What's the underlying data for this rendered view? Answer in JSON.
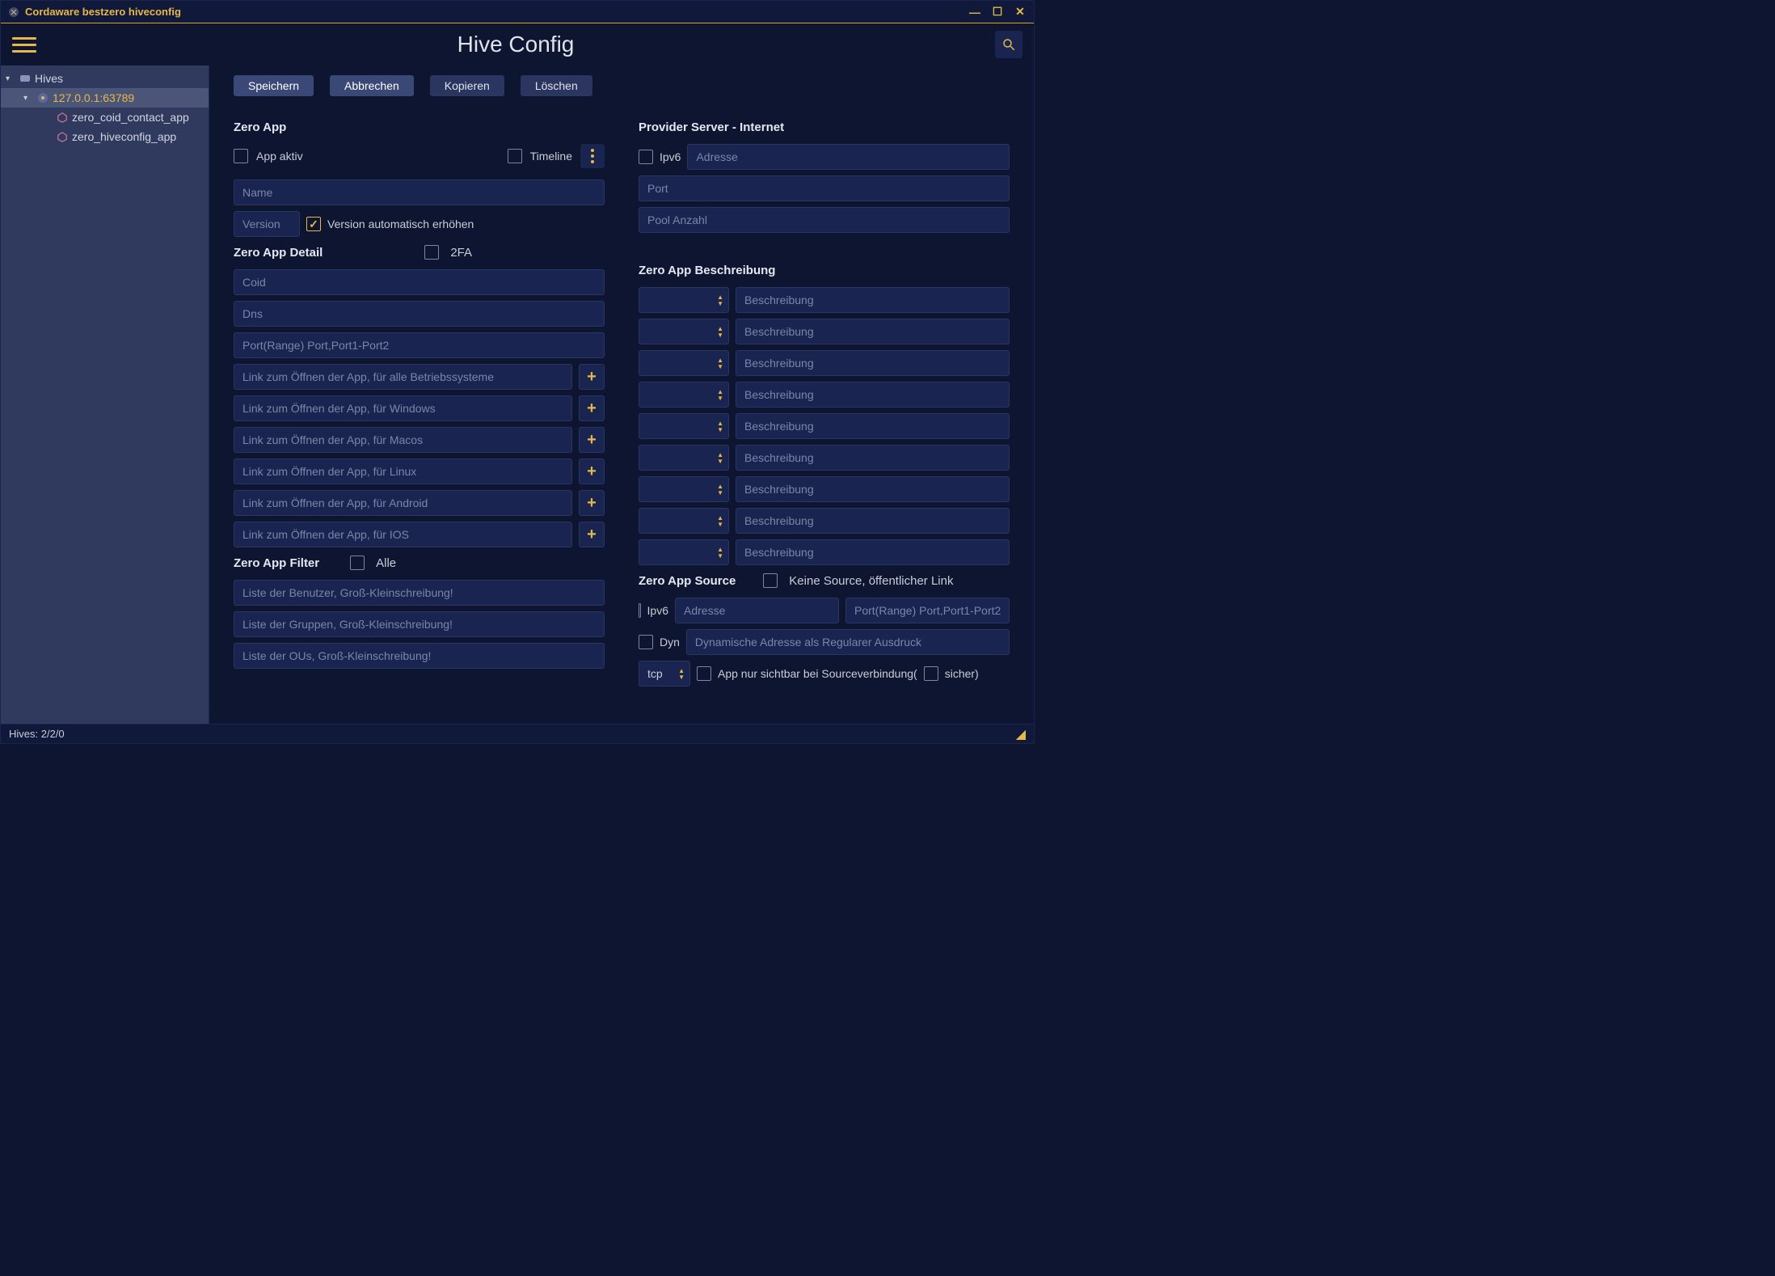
{
  "window": {
    "title": "Cordaware bestzero hiveconfig"
  },
  "header": {
    "page_title": "Hive Config"
  },
  "toolbar": {
    "save": "Speichern",
    "cancel": "Abbrechen",
    "copy": "Kopieren",
    "delete": "Löschen"
  },
  "tree": {
    "root": "Hives",
    "node": "127.0.0.1:63789",
    "app1": "zero_coid_contact_app",
    "app2": "zero_hiveconfig_app"
  },
  "zeroapp": {
    "title": "Zero App",
    "app_active": "App aktiv",
    "timeline": "Timeline",
    "name_ph": "Name",
    "version_ph": "Version",
    "version_auto": "Version automatisch erhöhen"
  },
  "detail": {
    "title": "Zero App Detail",
    "twofa": "2FA",
    "coid_ph": "Coid",
    "dns_ph": "Dns",
    "port_ph": "Port(Range) Port,Port1-Port2",
    "link_all": "Link zum Öffnen der App, für alle Betriebssysteme",
    "link_win": "Link zum Öffnen der App, für Windows",
    "link_mac": "Link zum Öffnen der App, für Macos",
    "link_lin": "Link zum Öffnen der App, für Linux",
    "link_and": "Link zum Öffnen der App, für Android",
    "link_ios": "Link zum Öffnen der App, für IOS"
  },
  "filter": {
    "title": "Zero App Filter",
    "all": "Alle",
    "users_ph": "Liste der Benutzer, Groß-Kleinschreibung!",
    "groups_ph": "Liste der Gruppen, Groß-Kleinschreibung!",
    "ous_ph": "Liste der OUs, Groß-Kleinschreibung!"
  },
  "provider": {
    "title": "Provider Server - Internet",
    "ipv6": "Ipv6",
    "addr_ph": "Adresse",
    "port_ph": "Port",
    "pool_ph": "Pool Anzahl"
  },
  "desc": {
    "title": "Zero App Beschreibung",
    "ph": "Beschreibung"
  },
  "source": {
    "title": "Zero App Source",
    "nosource": "Keine Source, öffentlicher Link",
    "ipv6": "Ipv6",
    "addr_ph": "Adresse",
    "port_ph": "Port(Range) Port,Port1-Port2",
    "dyn": "Dyn",
    "dyn_addr_ph": "Dynamische Adresse als Regularer Ausdruck",
    "tcp": "tcp",
    "visible_pre": "App nur sichtbar bei Sourceverbindung(",
    "sicher": "sicher)"
  },
  "status": {
    "hives": "Hives: 2/2/0"
  }
}
